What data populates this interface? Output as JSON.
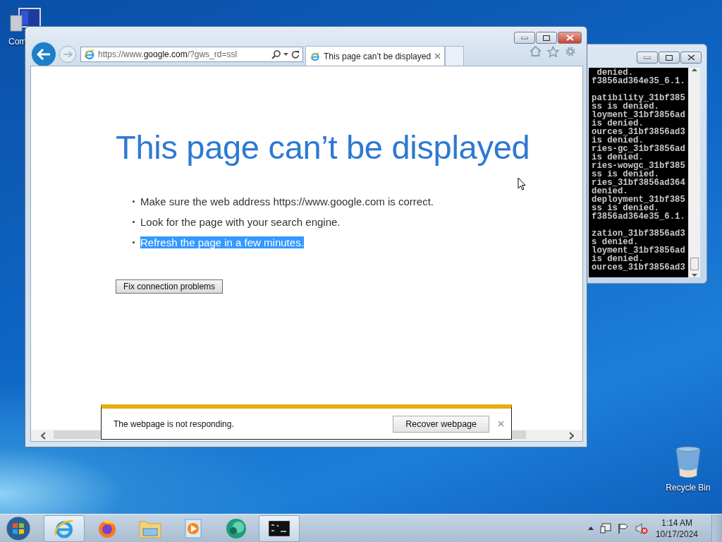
{
  "desktop_icons": [
    {
      "kind": "computer",
      "label": "Com"
    },
    {
      "kind": "recycle",
      "label": "Recycle Bin"
    }
  ],
  "console": {
    "blocks": [
      [
        " denied.",
        "f3856ad364e35_6.1."
      ],
      [
        "patibility_31bf385",
        "ss is denied.",
        "loyment_31bf3856ad",
        "is denied.",
        "ources_31bf3856ad3",
        "is denied.",
        "ries-gc_31bf3856ad",
        "is denied.",
        "ries-wowgc_31bf385",
        "ss is denied.",
        "ries_31bf3856ad364",
        "denied.",
        "deployment_31bf385",
        "ss is denied.",
        "f3856ad364e35_6.1."
      ],
      [
        "zation_31bf3856ad3",
        "s denied.",
        "loyment_31bf3856ad",
        "is denied.",
        "ources_31bf3856ad3"
      ]
    ]
  },
  "browser": {
    "address": "https://www.**google.com**/?gws_rd=ssl",
    "tabs": [
      {
        "title": "This page can’t be displayed",
        "selected": true
      }
    ],
    "heading": "This page can’t be displayed",
    "bullets": [
      {
        "text": "Make sure the web address https://www.google.com is correct.",
        "selected": false
      },
      {
        "text": "Look for the page with your search engine.",
        "selected": false
      },
      {
        "text": "Refresh the page in a few minutes.",
        "selected": true
      }
    ],
    "button": "Fix connection problems",
    "notification": {
      "message": "The webpage is not responding.",
      "button": "Recover webpage"
    }
  },
  "taskbar": {
    "apps": [
      {
        "kind": "ie",
        "active": true
      },
      {
        "kind": "firefox",
        "active": false
      },
      {
        "kind": "explorer",
        "active": false
      },
      {
        "kind": "media",
        "active": false
      },
      {
        "kind": "green",
        "active": false
      },
      {
        "kind": "cmd",
        "active": true
      }
    ],
    "clock": {
      "time": "1:14 AM",
      "date": "10/17/2024"
    }
  }
}
